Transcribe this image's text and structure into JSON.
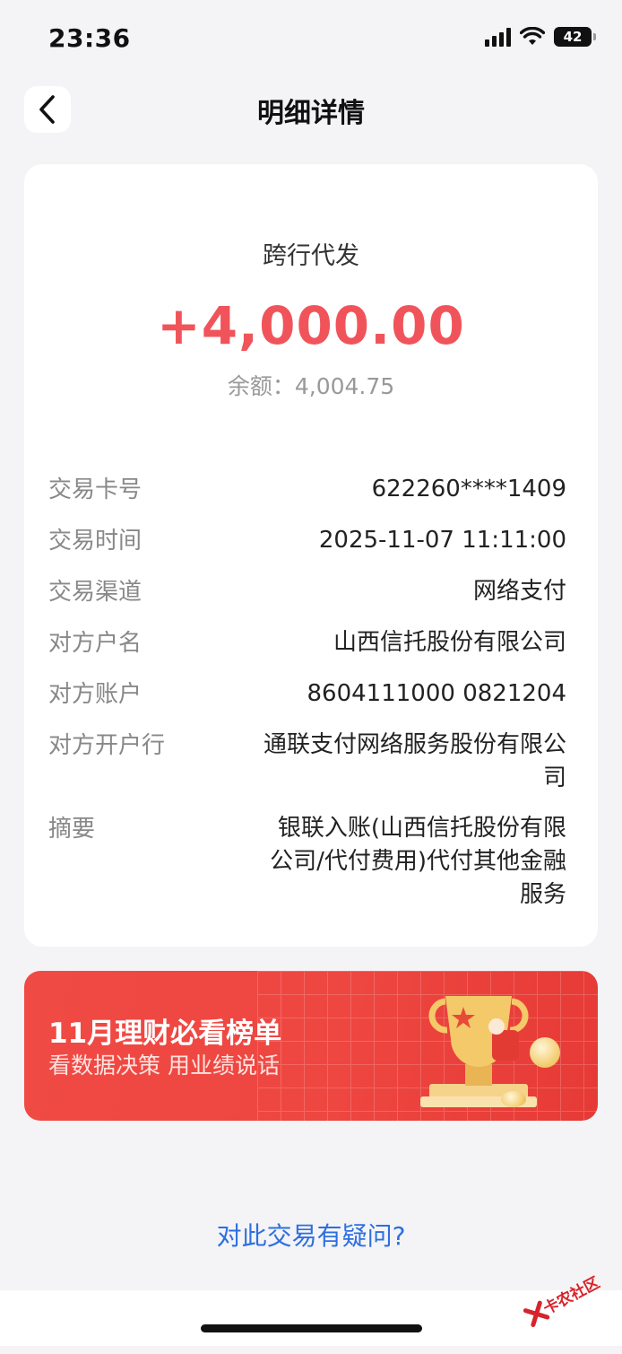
{
  "status_bar": {
    "time": "23:36",
    "battery": "42"
  },
  "nav": {
    "title": "明细详情"
  },
  "transaction": {
    "type": "跨行代发",
    "amount": "+4,000.00",
    "balance_label": "余额：",
    "balance_value": "4,004.75",
    "amount_color": "#f0545a"
  },
  "details": [
    {
      "label": "交易卡号",
      "value": "622260****1409"
    },
    {
      "label": "交易时间",
      "value": "2025-11-07 11:11:00"
    },
    {
      "label": "交易渠道",
      "value": "网络支付"
    },
    {
      "label": "对方户名",
      "value": "山西信托股份有限公司"
    },
    {
      "label": "对方账户",
      "value": "8604111000 0821204"
    },
    {
      "label": "对方开户行",
      "value": "通联支付网络服务股份有限公司"
    },
    {
      "label": "摘要",
      "value": "银联入账(山西信托股份有限公司/代付费用)代付其他金融服务"
    }
  ],
  "banner": {
    "title": "11月理财必看榜单",
    "subtitle": "看数据决策 用业绩说话",
    "color": "#ee4640"
  },
  "question_link": "对此交易有疑问?",
  "link_color": "#2d6fe0",
  "watermark": "卡农社区"
}
